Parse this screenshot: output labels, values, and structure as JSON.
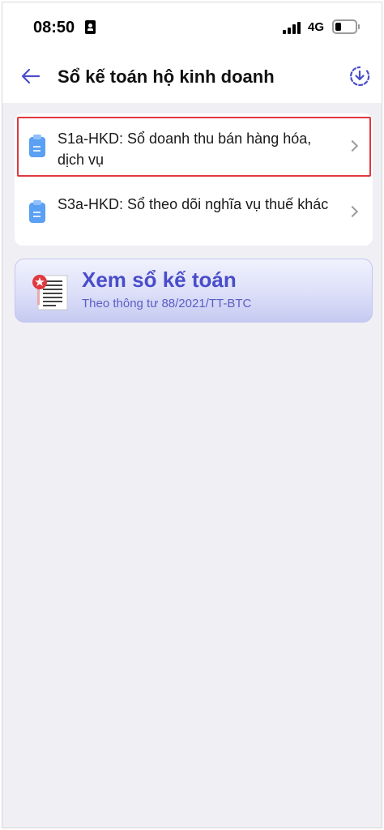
{
  "status_bar": {
    "time": "08:50",
    "network": "4G",
    "icons": [
      "id-badge-icon",
      "signal-icon",
      "battery-icon"
    ]
  },
  "header": {
    "back_icon": "arrow-left-icon",
    "title": "Sổ kế toán hộ kinh doanh",
    "download_icon": "download-circle-icon"
  },
  "book_list": {
    "items": [
      {
        "label": "S1a-HKD: Sổ doanh thu bán hàng hóa, dịch vụ",
        "icon": "clipboard-icon",
        "highlighted": true
      },
      {
        "label": "S3a-HKD: Sổ theo dõi nghĩa vụ thuế khác",
        "icon": "clipboard-icon",
        "highlighted": false
      }
    ]
  },
  "view_book": {
    "title": "Xem sổ kế toán",
    "subtitle": "Theo thông tư 88/2021/TT-BTC",
    "icon": "document-list-icon"
  },
  "colors": {
    "accent": "#4a4dc9",
    "highlight_border": "#e0393e",
    "background": "#efeff4"
  }
}
